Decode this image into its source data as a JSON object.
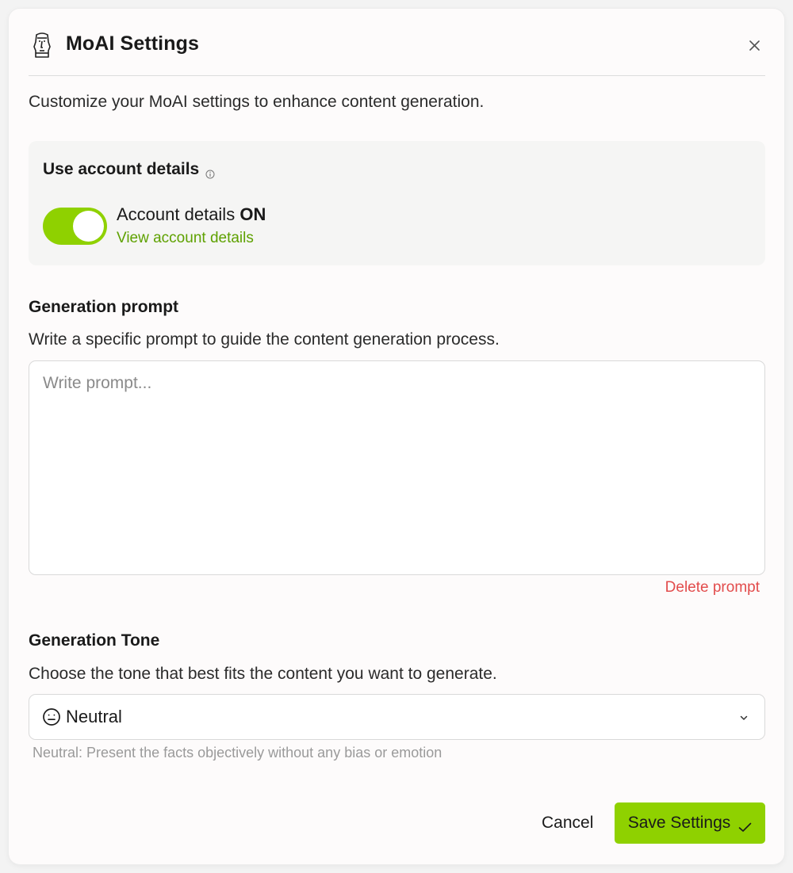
{
  "dialog": {
    "title": "MoAI Settings",
    "subtitle": "Customize your MoAI settings to enhance content generation."
  },
  "account": {
    "heading": "Use account details",
    "toggle_on": true,
    "status_prefix": "Account details",
    "status_value": "ON",
    "view_link": "View account details"
  },
  "prompt": {
    "heading": "Generation prompt",
    "description": "Write a specific prompt to guide the content generation process.",
    "placeholder": "Write prompt...",
    "value": "",
    "delete_label": "Delete prompt"
  },
  "tone": {
    "heading": "Generation Tone",
    "description": "Choose the tone that best fits the content you want to generate.",
    "selected": "Neutral",
    "selected_icon": "neutral-face-icon",
    "helper": "Neutral: Present the facts objectively without any bias or emotion"
  },
  "footer": {
    "cancel_label": "Cancel",
    "save_label": "Save Settings"
  },
  "colors": {
    "accent": "#8fd100",
    "link": "#5ea100",
    "danger": "#e24c4c"
  }
}
